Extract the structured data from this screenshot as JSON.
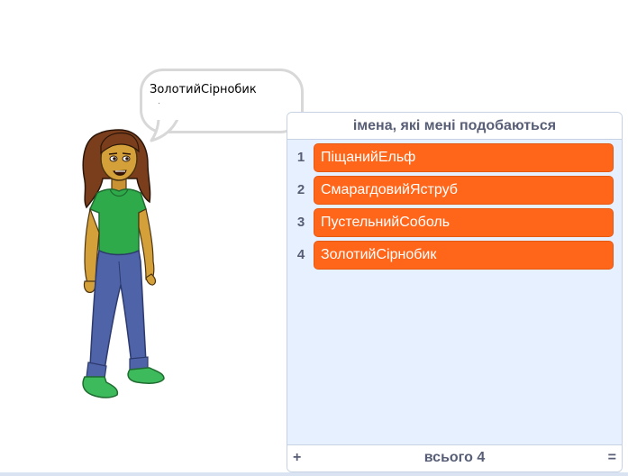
{
  "stage": {
    "speech_bubble": {
      "text": "ЗолотийСірнобик"
    },
    "sprite": {
      "icon": "girl-character"
    }
  },
  "list_monitor": {
    "title": "імена, які мені подобаються",
    "items": [
      {
        "index": "1",
        "value": "ПіщанийЕльф"
      },
      {
        "index": "2",
        "value": "СмарагдовийЯструб"
      },
      {
        "index": "3",
        "value": "ПустельнийСоболь"
      },
      {
        "index": "4",
        "value": "ЗолотийСірнобик"
      }
    ],
    "footer": {
      "add_label": "+",
      "length_label": "всього 4",
      "resize_label": "="
    }
  },
  "colors": {
    "item_fill": "#ff661a",
    "list_background": "#e6f0ff",
    "text_gray": "#575e75"
  }
}
